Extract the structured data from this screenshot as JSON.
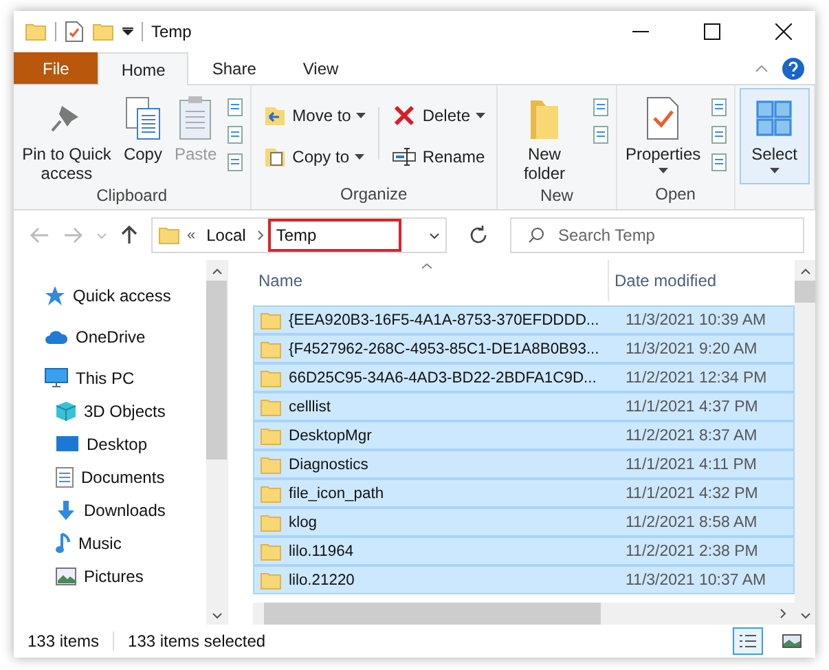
{
  "window": {
    "title": "Temp"
  },
  "tabs": [
    {
      "label": "File",
      "kind": "file",
      "selected": false
    },
    {
      "label": "Home",
      "kind": "tab",
      "selected": true
    },
    {
      "label": "Share",
      "kind": "tab",
      "selected": false
    },
    {
      "label": "View",
      "kind": "tab",
      "selected": false
    }
  ],
  "ribbon": [
    {
      "label": "Clipboard",
      "items": [
        {
          "kind": "large",
          "label": "Pin to Quick access",
          "dropdown": false,
          "disabled": false
        },
        {
          "kind": "large",
          "label": "Copy",
          "dropdown": false,
          "disabled": false
        },
        {
          "kind": "large",
          "label": "Paste",
          "dropdown": false,
          "disabled": true
        },
        {
          "kind": "stack"
        }
      ]
    },
    {
      "label": "Organize",
      "items": [
        {
          "kind": "small",
          "label": "Move to",
          "dropdown": true,
          "disabled": false
        },
        {
          "kind": "small",
          "label": "Copy to",
          "dropdown": true,
          "disabled": false
        },
        {
          "kind": "divider"
        },
        {
          "kind": "small",
          "label": "Delete",
          "dropdown": true,
          "disabled": false
        },
        {
          "kind": "small",
          "label": "Rename",
          "dropdown": false,
          "disabled": false
        }
      ]
    },
    {
      "label": "New",
      "items": [
        {
          "kind": "large",
          "label": "New folder",
          "dropdown": false,
          "disabled": false
        },
        {
          "kind": "stack"
        }
      ]
    },
    {
      "label": "Open",
      "items": [
        {
          "kind": "large",
          "label": "Properties",
          "dropdown": true,
          "disabled": false
        },
        {
          "kind": "stack"
        }
      ]
    },
    {
      "items": [
        {
          "kind": "toggle",
          "label": "Select",
          "dropdown": true,
          "disabled": false,
          "selected": true
        }
      ]
    }
  ],
  "address": {
    "overflow": "«",
    "crumbs": [
      {
        "label": "Local",
        "highlighted": false
      },
      {
        "label": "Temp",
        "highlighted": true
      }
    ]
  },
  "search": {
    "placeholder": "Search Temp"
  },
  "nav": [
    {
      "label": "Quick access"
    },
    {
      "label": "OneDrive"
    },
    {
      "label": "This PC",
      "children": [
        {
          "label": "3D Objects"
        },
        {
          "label": "Desktop"
        },
        {
          "label": "Documents"
        },
        {
          "label": "Downloads"
        },
        {
          "label": "Music"
        },
        {
          "label": "Pictures"
        }
      ]
    }
  ],
  "table": {
    "columns": [
      "Name",
      "Date modified"
    ],
    "rows": [
      {
        "name": "{EEA920B3-16F5-4A1A-8753-370EFDDDD...",
        "date": "11/3/2021 10:39 AM",
        "selected": true
      },
      {
        "name": "{F4527962-268C-4953-85C1-DE1A8B0B93...",
        "date": "11/3/2021 9:20 AM",
        "selected": true
      },
      {
        "name": "66D25C95-34A6-4AD3-BD22-2BDFA1C9D...",
        "date": "11/2/2021 12:34 PM",
        "selected": true
      },
      {
        "name": "celllist",
        "date": "11/1/2021 4:37 PM",
        "selected": true
      },
      {
        "name": "DesktopMgr",
        "date": "11/2/2021 8:37 AM",
        "selected": true
      },
      {
        "name": "Diagnostics",
        "date": "11/1/2021 4:11 PM",
        "selected": true
      },
      {
        "name": "file_icon_path",
        "date": "11/1/2021 4:32 PM",
        "selected": true
      },
      {
        "name": "klog",
        "date": "11/2/2021 8:58 AM",
        "selected": true
      },
      {
        "name": "lilo.11964",
        "date": "11/2/2021 2:38 PM",
        "selected": true
      },
      {
        "name": "lilo.21220",
        "date": "11/3/2021 10:37 AM",
        "selected": true
      }
    ]
  },
  "status_bar": {
    "count": "133 items",
    "selection": "133 items selected",
    "views": [
      {
        "kind": "details",
        "selected": true
      },
      {
        "kind": "tiles",
        "selected": false
      }
    ]
  }
}
